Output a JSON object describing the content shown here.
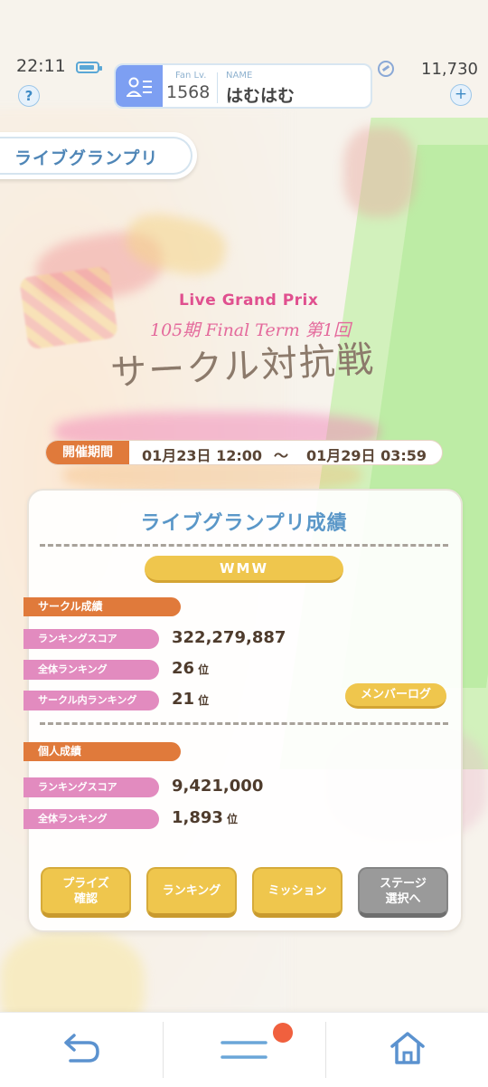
{
  "status": {
    "time": "22:11",
    "help": "?"
  },
  "profile": {
    "fan_label": "Fan Lv.",
    "fan_level": "1568",
    "name_label": "NAME",
    "name": "はむはむ"
  },
  "currency": {
    "amount": "11,730",
    "plus": "+"
  },
  "page_title": "ライブグランプリ",
  "logo": {
    "subtitle": "Live Grand Prix",
    "term": "105期 Final Term 第1回",
    "main": "サークル対抗戦"
  },
  "period": {
    "label": "開催期間",
    "start": "01月23日 12:00",
    "tilde": "～",
    "end": "01月29日 03:59"
  },
  "results": {
    "title": "ライブグランプリ成績",
    "circle_name": "WMW",
    "circle_section": {
      "label": "サークル成績",
      "score_label": "ランキングスコア",
      "score": "322,279,887",
      "overall_label": "全体ランキング",
      "overall": "26",
      "overall_unit": "位",
      "inner_label": "サークル内ランキング",
      "inner": "21",
      "inner_unit": "位",
      "member_log": "メンバーログ"
    },
    "personal_section": {
      "label": "個人成績",
      "score_label": "ランキングスコア",
      "score": "9,421,000",
      "overall_label": "全体ランキング",
      "overall": "1,893",
      "overall_unit": "位"
    }
  },
  "actions": {
    "prize": "プライズ\n確認",
    "ranking": "ランキング",
    "mission": "ミッション",
    "stage": "ステージ\n選択へ"
  },
  "nav": {
    "back": "back-icon",
    "menu": "menu-icon",
    "home": "home-icon"
  },
  "colors": {
    "accent_orange": "#e07a3b",
    "accent_pink": "#e28bbf",
    "accent_gold": "#efc64d",
    "title_blue": "#5a97c8"
  }
}
